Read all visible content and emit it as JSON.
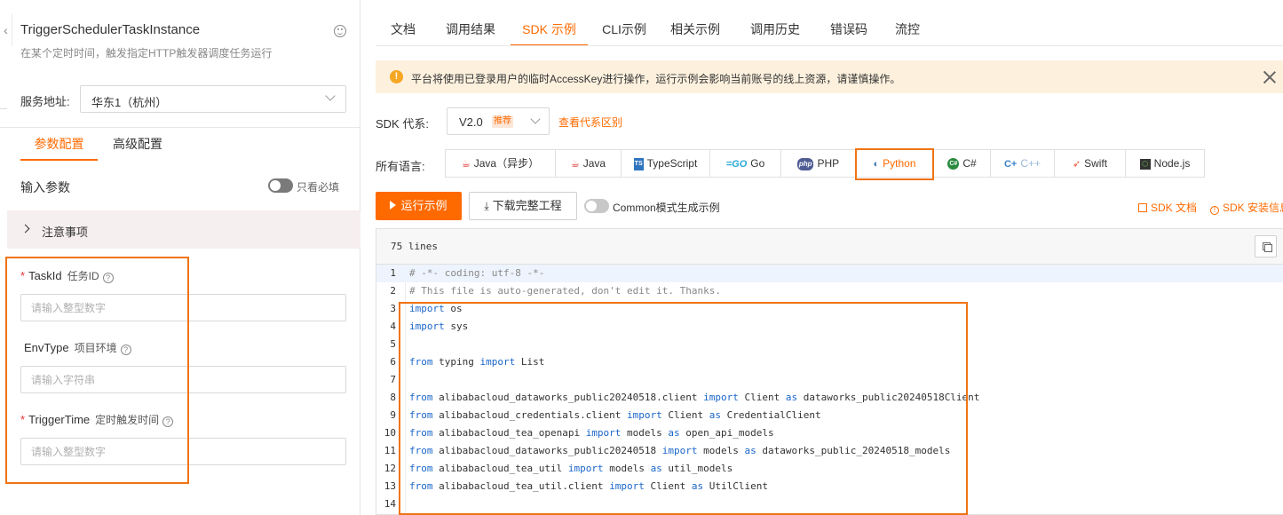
{
  "left_panel": {
    "api_title": "TriggerSchedulerTaskInstance",
    "api_desc": "在某个定时时间，触发指定HTTP触发器调度任务运行",
    "service_label": "服务地址:",
    "service_value": "华东1（杭州）",
    "tabs": {
      "param": "参数配置",
      "advanced": "高级配置"
    },
    "input_params_label": "输入参数",
    "required_only_label": "只看必填",
    "notice_label": "注意事项",
    "fields": [
      {
        "name": "TaskId",
        "cn": "任务ID",
        "required": "*",
        "placeholder": "请输入整型数字"
      },
      {
        "name": "EnvType",
        "cn": "项目环境",
        "required": "",
        "placeholder": "请输入字符串"
      },
      {
        "name": "TriggerTime",
        "cn": "定时触发时间",
        "required": "*",
        "placeholder": "请输入整型数字"
      }
    ]
  },
  "top_tabs": [
    "文档",
    "调用结果",
    "SDK 示例",
    "CLI示例",
    "相关示例",
    "调用历史",
    "错误码",
    "流控"
  ],
  "active_top_tab": "SDK 示例",
  "warning": {
    "text": "平台将使用已登录用户的临时AccessKey进行操作，运行示例会影响当前账号的线上资源，请谨慎操作。",
    "icon": "!"
  },
  "sdk": {
    "label": "SDK 代系:",
    "version": "V2.0",
    "badge": "推荐",
    "diff_link": "查看代系区别"
  },
  "languages": {
    "label": "所有语言:",
    "items": [
      {
        "label": "Java（异步）",
        "icon": "java-icon"
      },
      {
        "label": "Java",
        "icon": "java-icon"
      },
      {
        "label": "TypeScript",
        "icon": "typescript-icon"
      },
      {
        "label": "Go",
        "icon": "go-icon"
      },
      {
        "label": "PHP",
        "icon": "php-icon"
      },
      {
        "label": "Python",
        "icon": "python-icon"
      },
      {
        "label": "C#",
        "icon": "csharp-icon"
      },
      {
        "label": "C++",
        "icon": "cpp-icon"
      },
      {
        "label": "Swift",
        "icon": "swift-icon"
      },
      {
        "label": "Node.js",
        "icon": "nodejs-icon"
      }
    ],
    "active": "Python"
  },
  "actions": {
    "run": "运行示例",
    "download": "下载完整工程",
    "common_mode": "Common模式生成示例",
    "sdk_doc": "SDK 文档",
    "sdk_install": "SDK 安装信息"
  },
  "code": {
    "lines_label": "75 lines",
    "lines": [
      {
        "n": "1",
        "tokens": [
          [
            "cmt",
            "# -*- coding: utf-8 -*-"
          ]
        ]
      },
      {
        "n": "2",
        "tokens": [
          [
            "cmt",
            "# This file is auto-generated, don't edit it. Thanks."
          ]
        ]
      },
      {
        "n": "3",
        "tokens": [
          [
            "kw",
            "import"
          ],
          [
            "",
            " os"
          ]
        ]
      },
      {
        "n": "4",
        "tokens": [
          [
            "kw",
            "import"
          ],
          [
            "",
            " sys"
          ]
        ]
      },
      {
        "n": "5",
        "tokens": []
      },
      {
        "n": "6",
        "tokens": [
          [
            "kw",
            "from"
          ],
          [
            "",
            " typing "
          ],
          [
            "kw",
            "import"
          ],
          [
            "",
            " List"
          ]
        ]
      },
      {
        "n": "7",
        "tokens": []
      },
      {
        "n": "8",
        "tokens": [
          [
            "kw",
            "from"
          ],
          [
            "",
            " alibabacloud_dataworks_public20240518.client "
          ],
          [
            "kw",
            "import"
          ],
          [
            "",
            " Client "
          ],
          [
            "kw",
            "as"
          ],
          [
            "",
            " dataworks_public20240518Client"
          ]
        ]
      },
      {
        "n": "9",
        "tokens": [
          [
            "kw",
            "from"
          ],
          [
            "",
            " alibabacloud_credentials.client "
          ],
          [
            "kw",
            "import"
          ],
          [
            "",
            " Client "
          ],
          [
            "kw",
            "as"
          ],
          [
            "",
            " CredentialClient"
          ]
        ]
      },
      {
        "n": "10",
        "tokens": [
          [
            "kw",
            "from"
          ],
          [
            "",
            " alibabacloud_tea_openapi "
          ],
          [
            "kw",
            "import"
          ],
          [
            "",
            " models "
          ],
          [
            "kw",
            "as"
          ],
          [
            "",
            " open_api_models"
          ]
        ]
      },
      {
        "n": "11",
        "tokens": [
          [
            "kw",
            "from"
          ],
          [
            "",
            " alibabacloud_dataworks_public20240518 "
          ],
          [
            "kw",
            "import"
          ],
          [
            "",
            " models "
          ],
          [
            "kw",
            "as"
          ],
          [
            "",
            " dataworks_public_20240518_models"
          ]
        ]
      },
      {
        "n": "12",
        "tokens": [
          [
            "kw",
            "from"
          ],
          [
            "",
            " alibabacloud_tea_util "
          ],
          [
            "kw",
            "import"
          ],
          [
            "",
            " models "
          ],
          [
            "kw",
            "as"
          ],
          [
            "",
            " util_models"
          ]
        ]
      },
      {
        "n": "13",
        "tokens": [
          [
            "kw",
            "from"
          ],
          [
            "",
            " alibabacloud_tea_util.client "
          ],
          [
            "kw",
            "import"
          ],
          [
            "",
            " Client "
          ],
          [
            "kw",
            "as"
          ],
          [
            "",
            " UtilClient"
          ]
        ]
      },
      {
        "n": "14",
        "tokens": []
      }
    ]
  },
  "colors": {
    "accent": "#ff6a00",
    "highlight_box": "#f07313",
    "keyword": "#1a66c9",
    "comment": "#888888",
    "warning_bg": "#fdf1de"
  }
}
